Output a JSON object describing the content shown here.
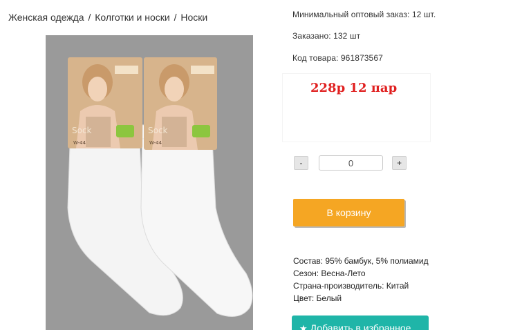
{
  "breadcrumb": {
    "items": [
      "Женская одежда",
      "Колготки и носки",
      "Носки"
    ],
    "separator": "/"
  },
  "product_image": {
    "alt": "Носки",
    "package_label": "Sock",
    "package_code": "W-44",
    "background_color": "#9a9a9a"
  },
  "info": {
    "min_order": "Минимальный оптовый заказ: 12 шт.",
    "ordered": "Заказано: 132 шт",
    "sku": "Код товара: 961873567"
  },
  "price": {
    "text": "228р 12 пар",
    "color": "#e02020"
  },
  "quantity": {
    "minus_label": "-",
    "value": "0",
    "plus_label": "+"
  },
  "cart": {
    "label": "В корзину",
    "color": "#f5a623"
  },
  "specs": {
    "composition": "Состав: 95% бамбук, 5% полиамид",
    "season": "Сезон: Весна-Лето",
    "country": "Страна-производитель: Китай",
    "color": "Цвет: Белый"
  },
  "favorite": {
    "label": "Добавить в избранное",
    "icon": "star-icon",
    "color": "#1fb5a8"
  }
}
